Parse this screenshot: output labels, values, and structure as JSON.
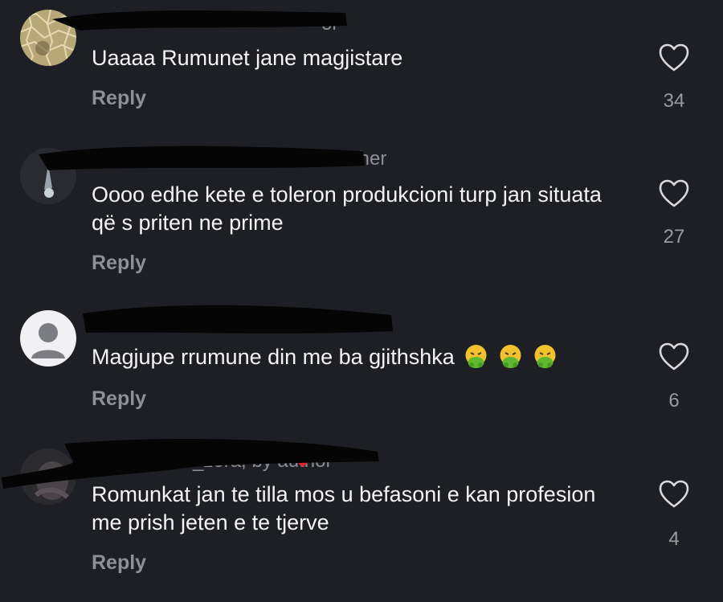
{
  "comments": [
    {
      "meta_visible": "or",
      "text": "Uaaaa Rumunet jane magjistare",
      "reply_label": "Reply",
      "likes": "34",
      "avatar": "gold-pattern"
    },
    {
      "meta_visible": "ther",
      "text": "Oooo edhe kete e toleron produkcioni turp jan situata që s priten ne prime",
      "reply_label": "Reply",
      "likes": "27",
      "avatar": "dark-photo"
    },
    {
      "meta_visible": "",
      "text": "Magjupe rrumune din me ba gjithshka",
      "reply_label": "Reply",
      "likes": "6",
      "avatar": "default-person",
      "emoji_count": 3
    },
    {
      "meta_visible": "_zora, by author",
      "text": "Romunkat jan te tilla mos u befasoni e kan profesion me prish jeten e te tjerve",
      "reply_label": "Reply",
      "likes": "4",
      "avatar": "dark-photo"
    }
  ],
  "colors": {
    "background": "#1e1f24",
    "text": "#f4f4f4",
    "muted": "#8d8e94",
    "redaction": "#050506"
  },
  "icons": {
    "like": "heart-outline-icon",
    "emoji": "nauseated-face-emoji-icon"
  }
}
